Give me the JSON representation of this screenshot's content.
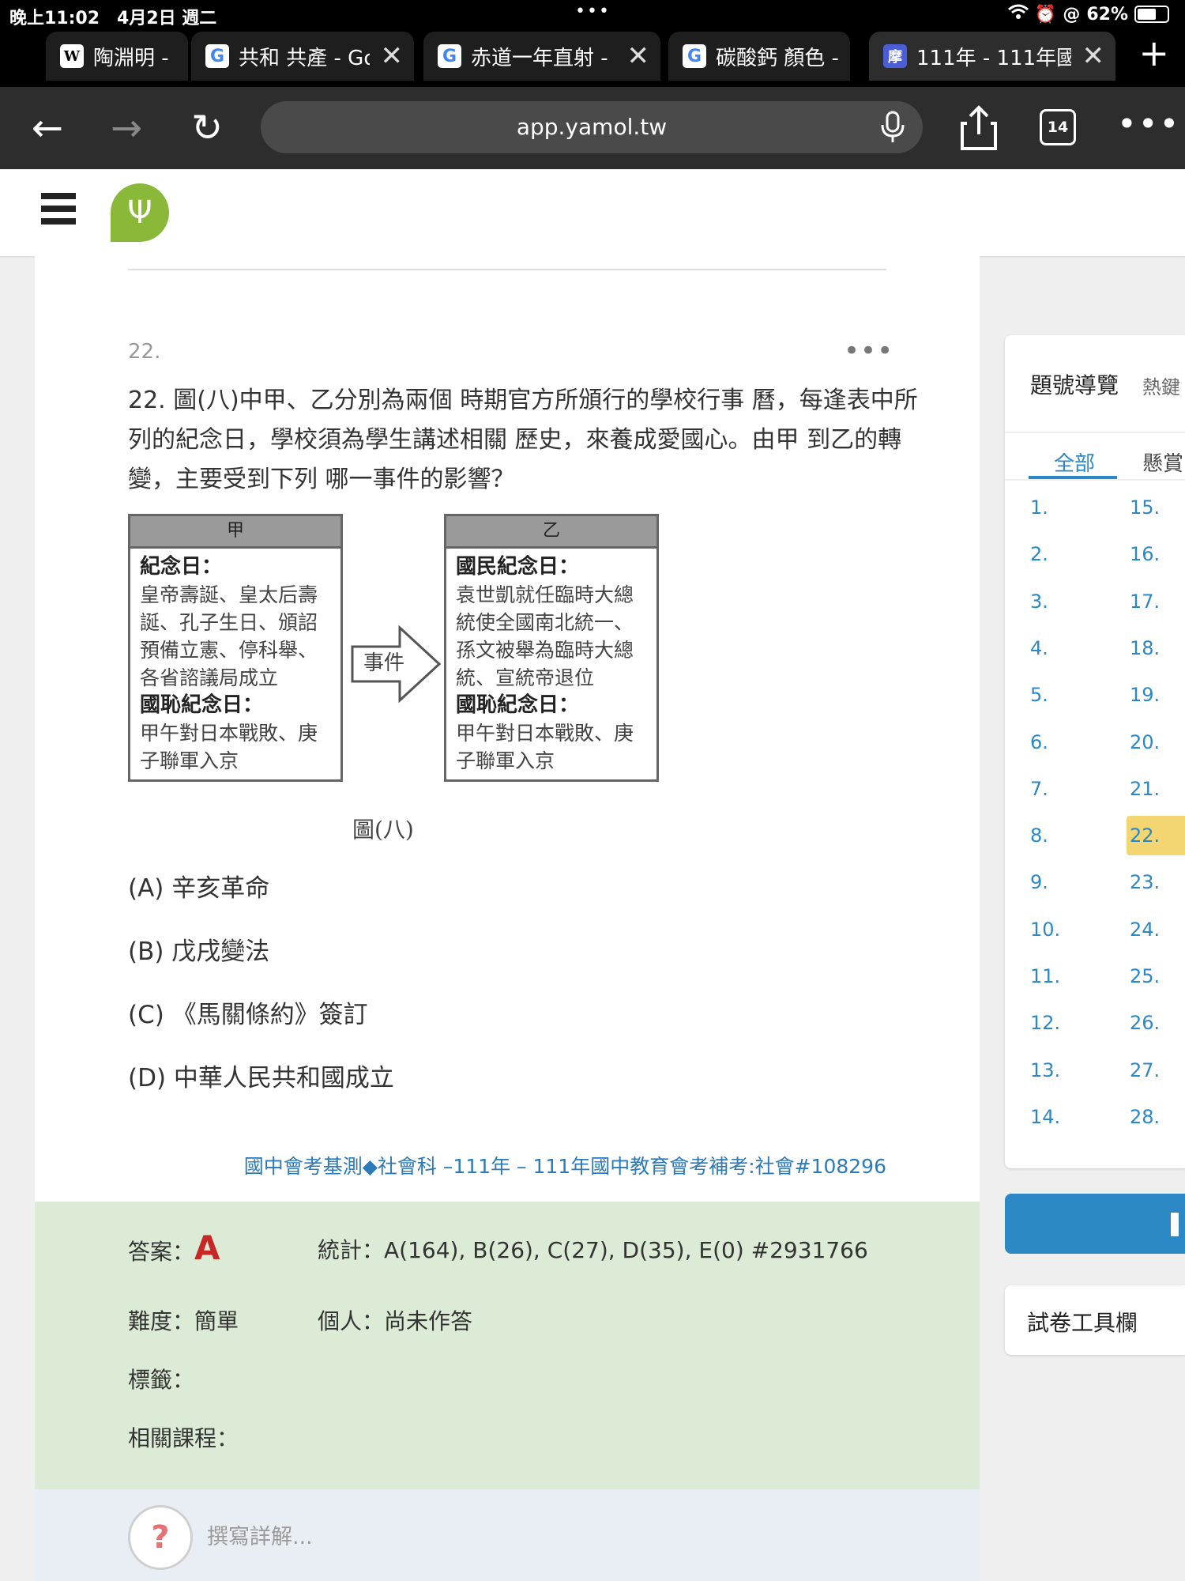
{
  "status_bar": {
    "time": "晚上11:02　4月2日 週二",
    "battery": "62%",
    "dots": "•••"
  },
  "tabs": [
    {
      "title": "陶淵明 -",
      "icon": "W"
    },
    {
      "title": "共和 共產 - Goo",
      "icon": "G"
    },
    {
      "title": "赤道一年直射 -",
      "icon": "G"
    },
    {
      "title": "碳酸鈣 顏色 -",
      "icon": "G"
    },
    {
      "title": "111年 - 111年國",
      "icon": "摩"
    }
  ],
  "toolbar": {
    "url": "app.yamol.tw",
    "tab_count": "14"
  },
  "question": {
    "number": "22.",
    "text": "22. 圖(八)中甲、乙分別為兩個 時期官方所頒行的學校行事 曆，每逢表中所列的紀念日，學校須為學生講述相關 歷史，來養成愛國心。由甲 到乙的轉變，主要受到下列 哪一事件的影響？",
    "figure": {
      "left_header": "甲",
      "left_h1": "紀念日：",
      "left_t1": "皇帝壽誕、皇太后壽誕、孔子生日、頒詔預備立憲、停科舉、各省諮議局成立",
      "left_h2": "國恥紀念日：",
      "left_t2": "甲午對日本戰敗、庚子聯軍入京",
      "arrow_label": "事件",
      "right_header": "乙",
      "right_h1": "國民紀念日：",
      "right_t1": "袁世凱就任臨時大總統使全國南北統一、孫文被舉為臨時大總統、宣統帝退位",
      "right_h2": "國恥紀念日：",
      "right_t2": "甲午對日本戰敗、庚子聯軍入京",
      "caption": "圖(八)"
    },
    "options": [
      "(A) 辛亥革命",
      "(B) 戊戌變法",
      "(C) 《馬關條約》簽訂",
      "(D) 中華人民共和國成立"
    ],
    "source": "國中會考基測◆社會科 –111年 – 111年國中教育會考補考:社會#108296"
  },
  "answer": {
    "answer_label": "答案：",
    "answer_value": "A",
    "stats": "統計：A(164), B(26), C(27), D(35), E(0) #2931766",
    "difficulty": "難度：簡單",
    "personal": "個人：尚未作答",
    "tags": "標籤：",
    "courses": "相關課程："
  },
  "comment": {
    "placeholder": "撰寫詳解..."
  },
  "sidebar": {
    "title": "題號導覽",
    "title2": "熱鍵",
    "tab_all": "全部",
    "tab_bounty": "懸賞",
    "col1": [
      "1.",
      "2.",
      "3.",
      "4.",
      "5.",
      "6.",
      "7.",
      "8.",
      "9.",
      "10.",
      "11.",
      "12.",
      "13.",
      "14."
    ],
    "col2": [
      "15.",
      "16.",
      "17.",
      "18.",
      "19.",
      "20.",
      "21.",
      "22.",
      "23.",
      "24.",
      "25.",
      "26.",
      "27.",
      "28."
    ],
    "current": "22.",
    "toolbox": "試卷工具欄"
  },
  "colors": {
    "accent": "#2c87c5",
    "answer_bg": "#dcebd5",
    "answer_value": "#c62828",
    "highlight": "#f3d571",
    "logo": "#8ab838"
  }
}
